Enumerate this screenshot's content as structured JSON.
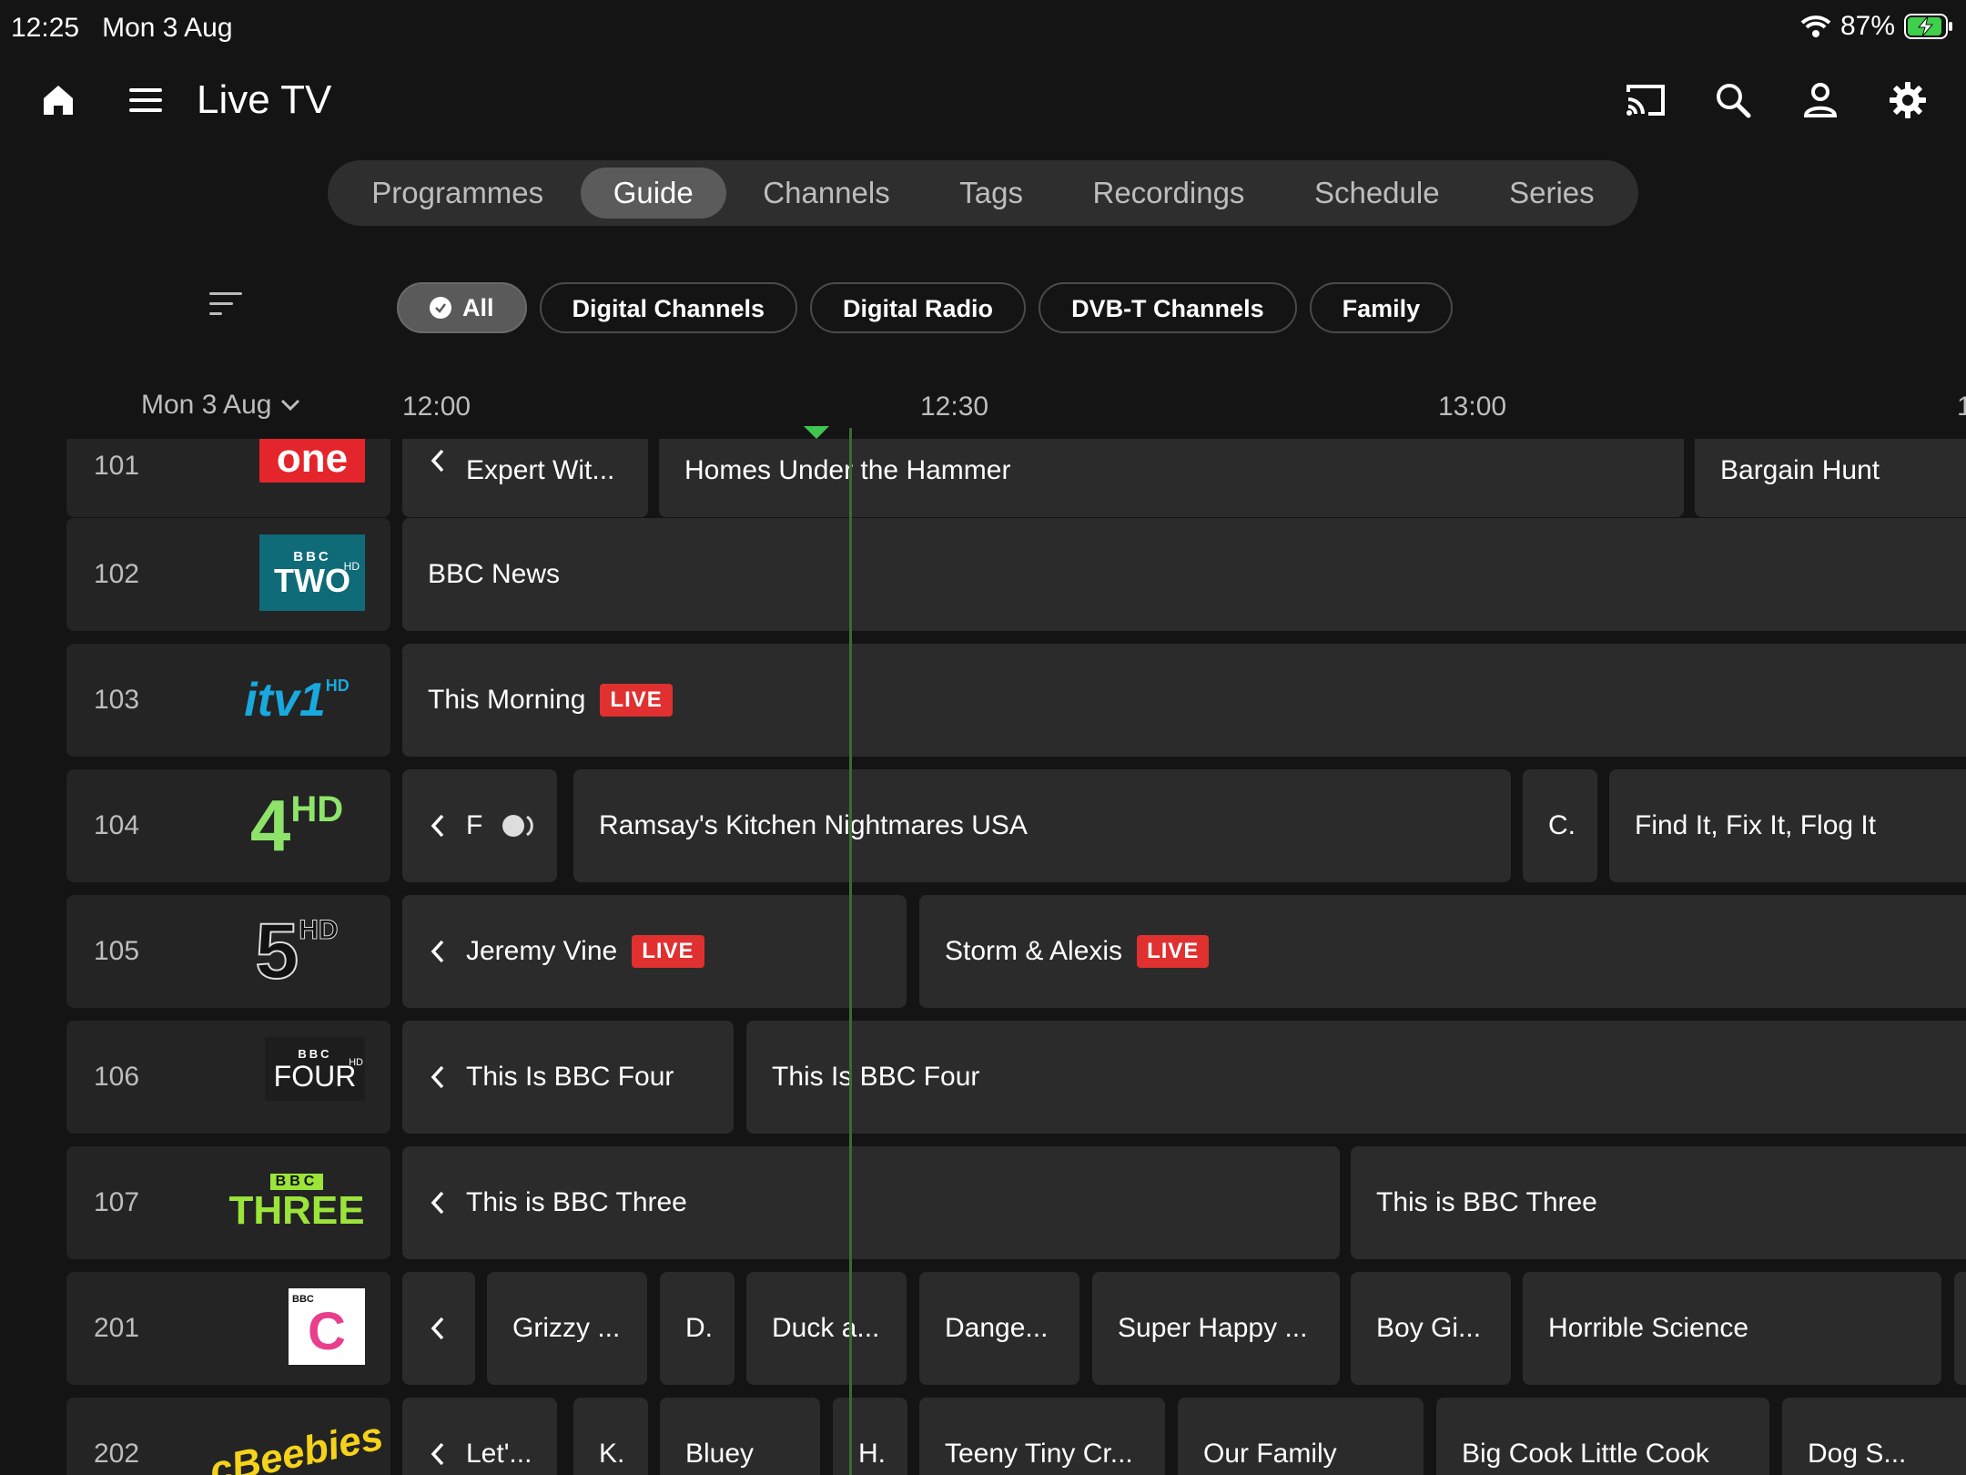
{
  "status_bar": {
    "time": "12:25",
    "date": "Mon 3 Aug",
    "battery": "87%"
  },
  "header": {
    "title": "Live TV"
  },
  "tabs": [
    "Programmes",
    "Guide",
    "Channels",
    "Tags",
    "Recordings",
    "Schedule",
    "Series"
  ],
  "active_tab": "Guide",
  "filters": [
    "All",
    "Digital Channels",
    "Digital Radio",
    "DVB-T Channels",
    "Family"
  ],
  "active_filter": "All",
  "timeline": {
    "date": "Mon 3 Aug",
    "times": [
      "12:00",
      "12:30",
      "13:00",
      "1"
    ]
  },
  "channels": [
    {
      "number": "101",
      "logo": "one",
      "programmes": [
        {
          "title": "Expert Wit...",
          "continued": true
        },
        {
          "title": "Homes Under the Hammer"
        },
        {
          "title": "Bargain Hunt"
        }
      ]
    },
    {
      "number": "102",
      "logo_top": "BBC",
      "logo": "TWO",
      "logo_badge": "HD",
      "programmes": [
        {
          "title": "BBC News"
        }
      ]
    },
    {
      "number": "103",
      "logo": "itv1",
      "logo_badge": "HD",
      "programmes": [
        {
          "title": "This Morning",
          "live": "LIVE"
        }
      ]
    },
    {
      "number": "104",
      "logo": "4",
      "logo_badge": "HD",
      "programmes": [
        {
          "title": "F",
          "continued": true
        },
        {
          "title": "Ramsay's Kitchen Nightmares USA"
        },
        {
          "title": "C."
        },
        {
          "title": "Find It, Fix It, Flog It"
        }
      ]
    },
    {
      "number": "105",
      "logo": "5",
      "logo_badge": "HD",
      "programmes": [
        {
          "title": "Jeremy Vine",
          "live": "LIVE",
          "continued": true
        },
        {
          "title": "Storm & Alexis",
          "live": "LIVE"
        }
      ]
    },
    {
      "number": "106",
      "logo_top": "BBC",
      "logo": "FOUR",
      "logo_badge": "HD",
      "programmes": [
        {
          "title": "This Is BBC Four",
          "continued": true
        },
        {
          "title": "This Is BBC Four"
        }
      ]
    },
    {
      "number": "107",
      "logo_top": "BBC",
      "logo": "THREE",
      "programmes": [
        {
          "title": "This is BBC Three",
          "continued": true
        },
        {
          "title": "This is BBC Three"
        }
      ]
    },
    {
      "number": "201",
      "logo_top": "BBC",
      "logo": "C",
      "programmes": [
        {
          "title": "",
          "continued": true
        },
        {
          "title": "Grizzy ..."
        },
        {
          "title": "D."
        },
        {
          "title": "Duck a..."
        },
        {
          "title": "Dange..."
        },
        {
          "title": "Super Happy ..."
        },
        {
          "title": "Boy Gi..."
        },
        {
          "title": "Horrible Science"
        },
        {
          "title": ""
        }
      ]
    },
    {
      "number": "202",
      "logo": "cBeebies",
      "programmes": [
        {
          "title": "Let'...",
          "continued": true
        },
        {
          "title": "K."
        },
        {
          "title": "Bluey"
        },
        {
          "title": "H."
        },
        {
          "title": "Teeny Tiny Cr..."
        },
        {
          "title": "Our Family"
        },
        {
          "title": "Big Cook Little Cook"
        },
        {
          "title": "Dog S..."
        }
      ]
    }
  ],
  "colors": {
    "live_badge": "#e03030",
    "now_line": "#3fc64f",
    "bbc_one": "#e4252b",
    "bbc_two": "#0f6b77",
    "itv": "#18a9df",
    "ch4": "#8ee36b",
    "bbc_three": "#9be43a"
  }
}
